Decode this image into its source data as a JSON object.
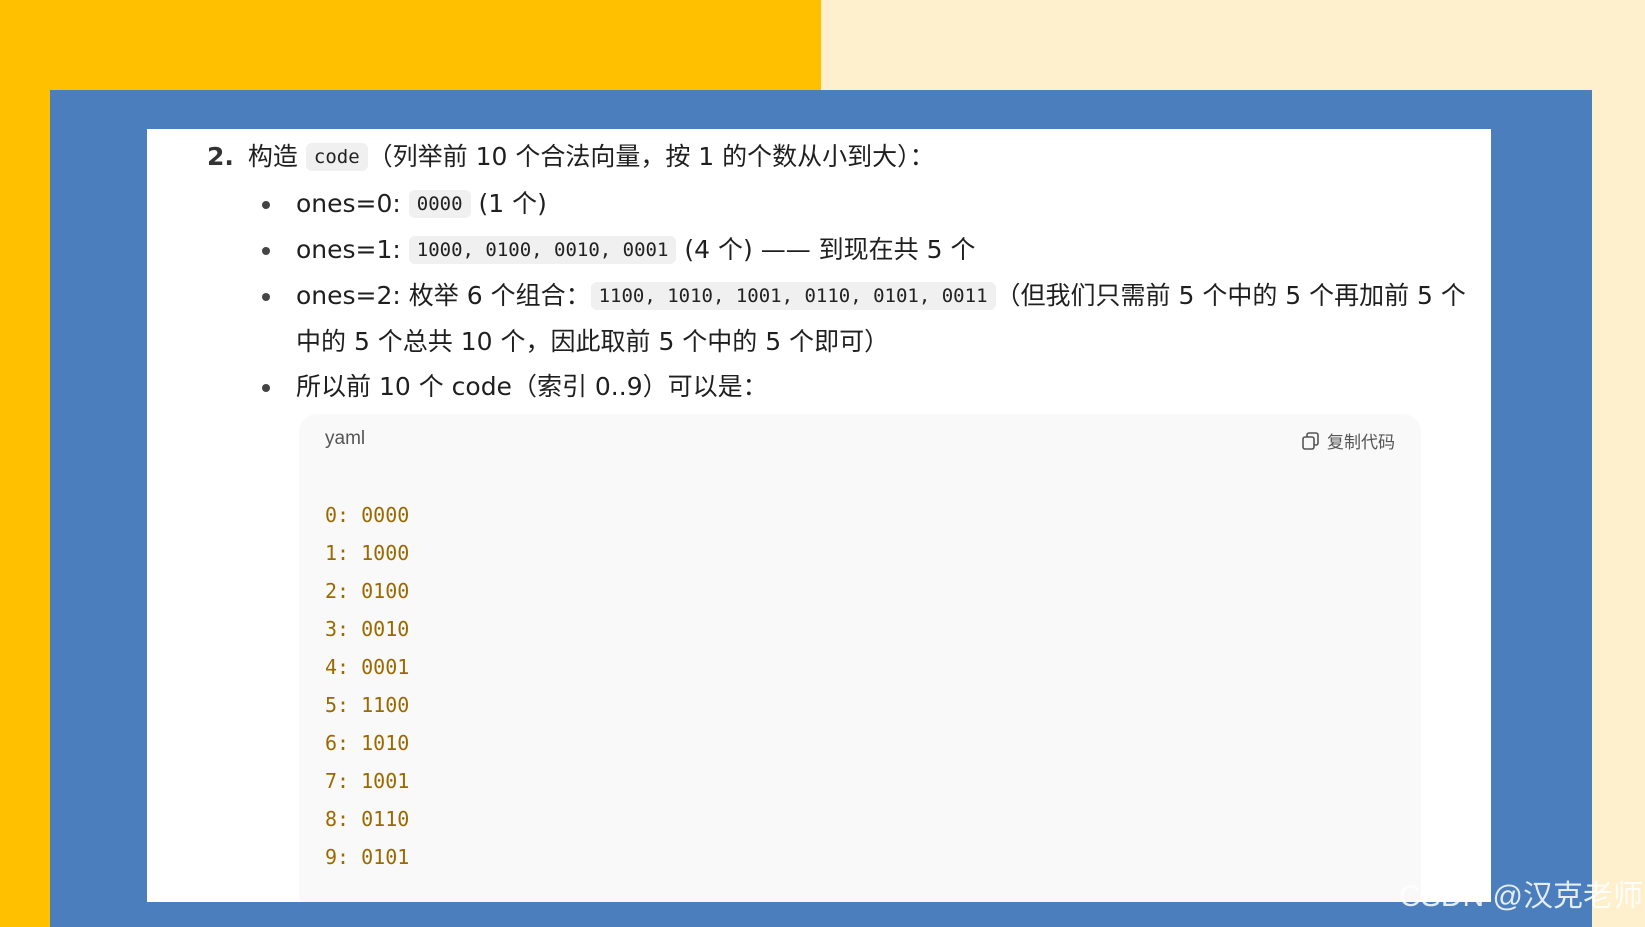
{
  "heading": {
    "number": "2.",
    "prefix": "构造",
    "code": "code",
    "suffix": "（列举前 10 个合法向量，按 1 的个数从小到大）："
  },
  "bullets": [
    {
      "text_before": "ones=0: ",
      "code": "0000",
      "text_after": " (1 个)"
    },
    {
      "text_before": "ones=1: ",
      "code": "1000, 0100, 0010, 0001",
      "text_after": " (4 个) —— 到现在共 5 个"
    },
    {
      "text_before": "ones=2: 枚举 6 个组合：",
      "code": "1100, 1010, 1001, 0110, 0101, 0011",
      "text_after": "（但我们只需前 5 个中的 5 个再加前 5 个中的 5 个总共 10 个，因此取前 5 个中的 5 个即可）"
    },
    {
      "text_before": "所以前 10 个 code（索引 0..9）可以是：",
      "code": "",
      "text_after": ""
    }
  ],
  "code_block": {
    "language": "yaml",
    "copy_label": "复制代码",
    "copy_icon": "copy-icon",
    "lines": [
      "0: 0000",
      "1: 1000",
      "2: 0100",
      "3: 0010",
      "4: 0001",
      "5: 1100",
      "6: 1010",
      "7: 1001",
      "8: 0110",
      "9: 0101"
    ]
  },
  "watermark": "CSDN @汉克老师",
  "colors": {
    "left_background": "#ffc000",
    "right_background": "#fff0cd",
    "frame": "#4a7ebc",
    "code_text": "#9a6a00"
  }
}
